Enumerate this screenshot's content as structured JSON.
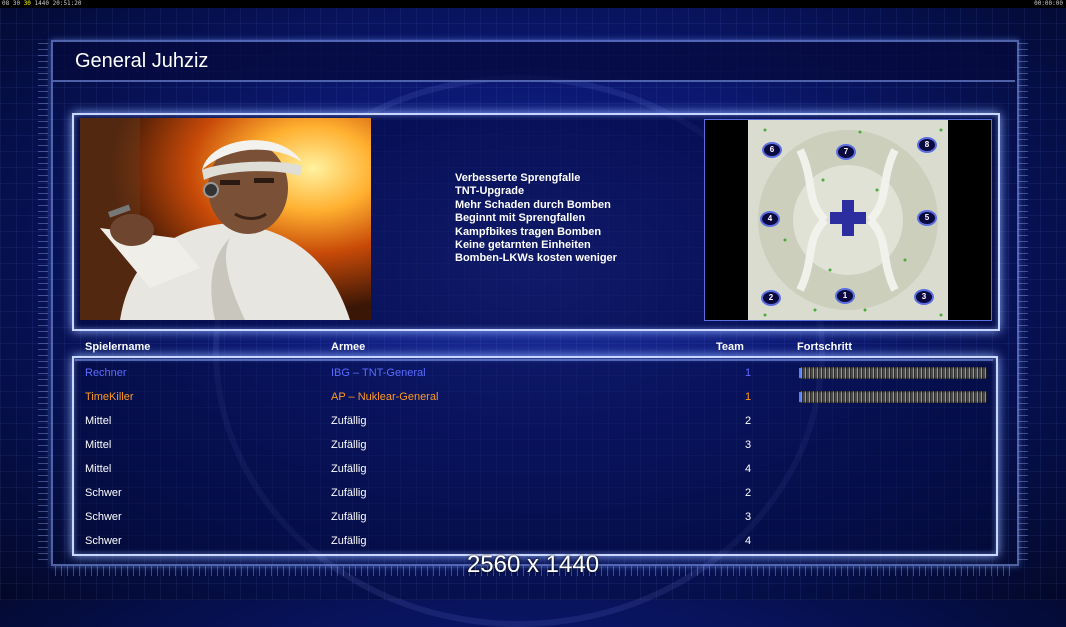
{
  "topbar": {
    "left_prefix": "08 30",
    "left_green": "30",
    "left_rest": "1440 20:51:20",
    "right": "00:00:00"
  },
  "title": "General Juhziz",
  "features": [
    "Verbesserte Sprengfalle",
    "TNT-Upgrade",
    "Mehr Schaden durch Bomben",
    "Beginnt mit Sprengfallen",
    "Kampfbikes tragen Bomben",
    "Keine getarnten Einheiten",
    "Bomben-LKWs kosten weniger"
  ],
  "minimap": {
    "start_positions": [
      "6",
      "7",
      "8",
      "4",
      "5",
      "2",
      "1",
      "3"
    ]
  },
  "table": {
    "headers": {
      "name": "Spielername",
      "army": "Armee",
      "team": "Team",
      "progress": "Fortschritt"
    },
    "rows": [
      {
        "name": "Rechner",
        "army": "IBG – TNT-General",
        "team": "1",
        "color": "#5b6cff",
        "progress": 0.0
      },
      {
        "name": "TimeKiller",
        "army": "AP – Nuklear-General",
        "team": "1",
        "color": "#ff9a1e",
        "progress": 0.0
      },
      {
        "name": "Mittel",
        "army": "Zufällig",
        "team": "2",
        "color": "#ffffff"
      },
      {
        "name": "Mittel",
        "army": "Zufällig",
        "team": "3",
        "color": "#ffffff"
      },
      {
        "name": "Mittel",
        "army": "Zufällig",
        "team": "4",
        "color": "#ffffff"
      },
      {
        "name": "Schwer",
        "army": "Zufällig",
        "team": "2",
        "color": "#ffffff"
      },
      {
        "name": "Schwer",
        "army": "Zufällig",
        "team": "3",
        "color": "#ffffff"
      },
      {
        "name": "Schwer",
        "army": "Zufällig",
        "team": "4",
        "color": "#ffffff"
      }
    ]
  },
  "resolution": "2560 x 1440"
}
